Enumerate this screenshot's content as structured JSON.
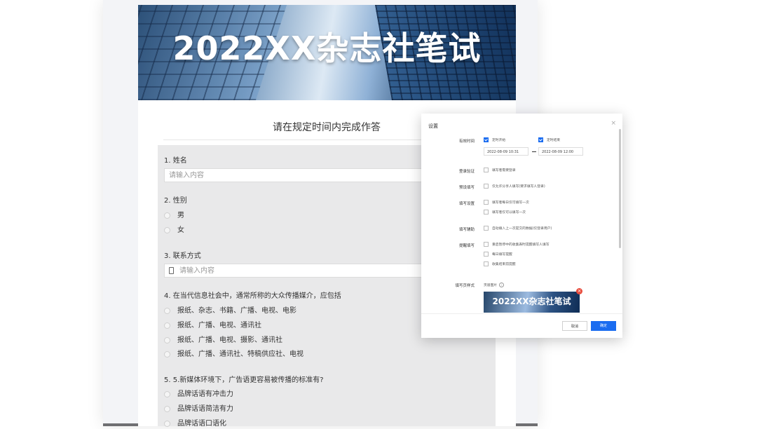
{
  "form": {
    "banner_title": "2022XX杂志社笔试",
    "heading": "请在规定时间内完成作答",
    "q1": {
      "title": "1. 姓名",
      "placeholder": "请输入内容"
    },
    "q2": {
      "title": "2. 性别",
      "options": [
        "男",
        "女"
      ]
    },
    "q3": {
      "title": "3. 联系方式",
      "placeholder": "请输入内容"
    },
    "q4": {
      "title": "4. 在当代信息社会中，通常所称的大众传播媒介，应包括",
      "options": [
        "报纸、杂志、书籍、广播、电视、电影",
        "报纸、广播、电视、通讯社",
        "报纸、广播、电视、摄影、通讯社",
        "报纸、广播、通讯社、特稿供应社、电视"
      ]
    },
    "q5": {
      "title": "5. 5.新媒体环境下，广告语更容易被传播的标准有?",
      "options": [
        "品牌话语有冲击力",
        "品牌话语简洁有力",
        "品牌话语口语化"
      ]
    }
  },
  "dialog": {
    "title": "设置",
    "close": "×",
    "valid_time": {
      "label": "有效时间",
      "start_label": "定时开始",
      "end_label": "定时结束",
      "start_value": "2022-08-09 10:31",
      "end_value": "2022-08-09 12:00",
      "start_checked": true,
      "end_checked": true
    },
    "login": {
      "label": "登录验证",
      "items": [
        "填写者需要登录"
      ]
    },
    "preset": {
      "label": "预设填写",
      "items": [
        "仅允许分享人填写(要求填写人登录)"
      ]
    },
    "fill_settings": {
      "label": "填写设置",
      "items": [
        "填写者每日仅可填写一次",
        "填写者仅可以填写一次"
      ]
    },
    "fill_assist": {
      "label": "填写辅助",
      "items": [
        "自动填入上一次提交的数据(仅登录用户)"
      ]
    },
    "reminder": {
      "label": "提醒填写",
      "items": [
        "重启暂停中的收集表时提醒填写人填写",
        "每日填写提醒",
        "收集结束前提醒"
      ]
    },
    "page_style": {
      "label": "填写页样式",
      "header_image_label": "页眉图片",
      "thumb_title": "2022XX杂志社笔试"
    },
    "cancel": "取消",
    "confirm": "确定"
  },
  "colors": {
    "primary": "#1a6cf0",
    "delete": "#e84c3d",
    "question_bg": "#e9e9ea"
  }
}
